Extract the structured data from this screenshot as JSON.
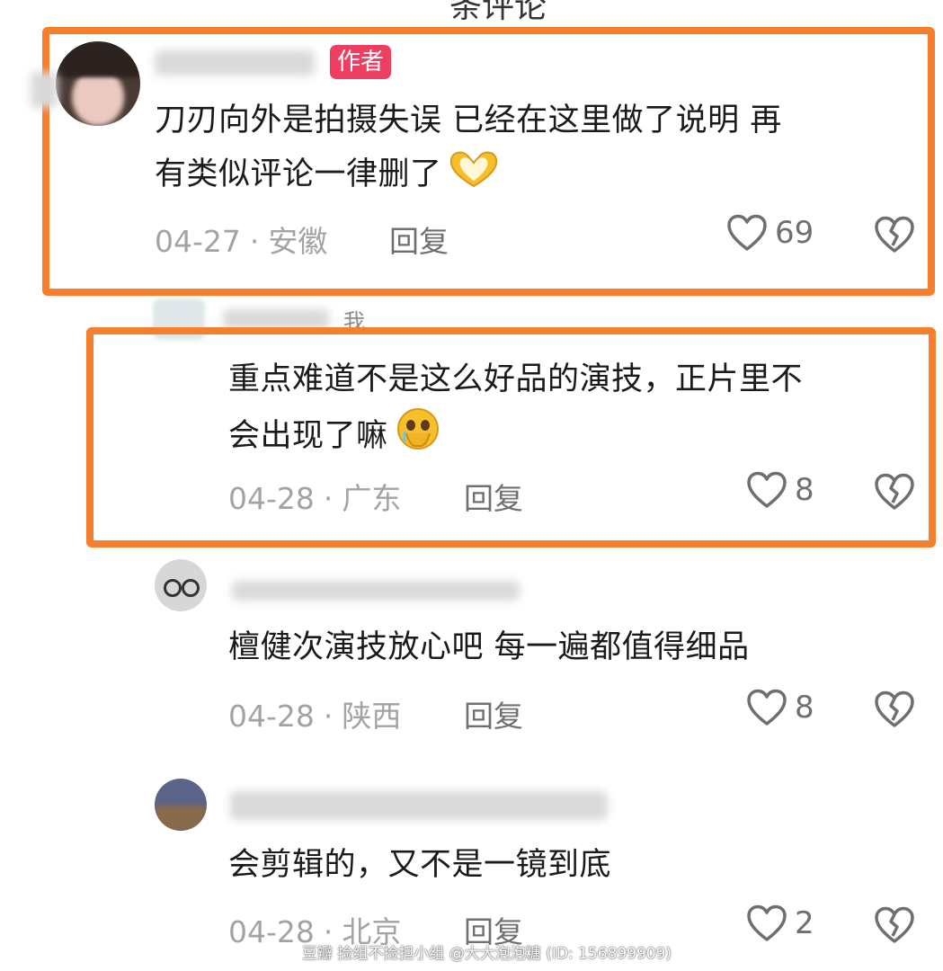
{
  "header": {
    "fragment": "条评论"
  },
  "comments": [
    {
      "badge": "作者",
      "text_line1": "刀刃向外是拍摄失误 已经在这里做了说明 再",
      "text_line2": "有类似评论一律删了",
      "emoji": "heart-hands-emoji",
      "date": "04-27",
      "location": "安徽",
      "reply": "回复",
      "likes": "69"
    },
    {
      "badge": "我",
      "text_line1": "重点难道不是这么好品的演技，正片里不",
      "text_line2": "会出现了嘛",
      "emoji": "pleading-crying-emoji",
      "date": "04-28",
      "location": "广东",
      "reply": "回复",
      "likes": "8"
    },
    {
      "text_line1": "檀健次演技放心吧 每一遍都值得细品",
      "date": "04-28",
      "location": "陕西",
      "reply": "回复",
      "likes": "8"
    },
    {
      "text_line1": "会剪辑的，又不是一镜到底",
      "date": "04-28",
      "location": "北京",
      "reply": "回复",
      "likes": "2"
    }
  ],
  "separator": "·",
  "watermark": "豆瓣  捡组不捡担小组 @大大泡泡糖 (ID: 156899909)",
  "colors": {
    "highlight": "#f57f2c",
    "author_badge": "#ee3f62"
  }
}
